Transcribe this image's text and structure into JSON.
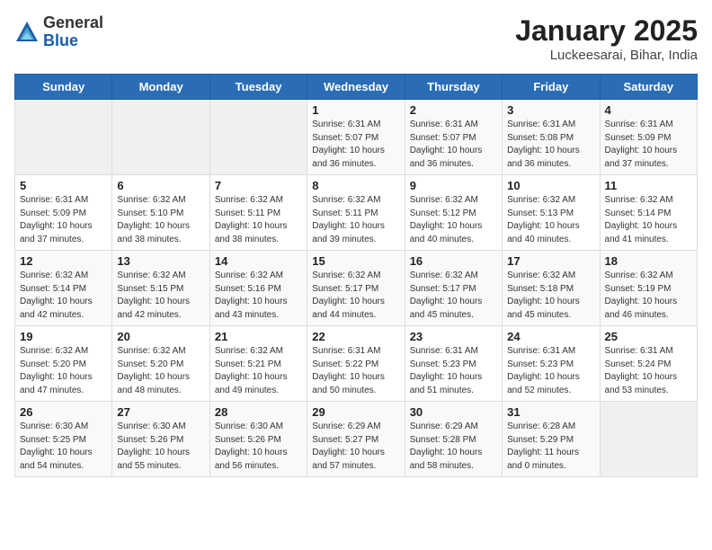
{
  "logo": {
    "general": "General",
    "blue": "Blue"
  },
  "header": {
    "title": "January 2025",
    "subtitle": "Luckeesarai, Bihar, India"
  },
  "weekdays": [
    "Sunday",
    "Monday",
    "Tuesday",
    "Wednesday",
    "Thursday",
    "Friday",
    "Saturday"
  ],
  "weeks": [
    [
      {
        "day": "",
        "info": ""
      },
      {
        "day": "",
        "info": ""
      },
      {
        "day": "",
        "info": ""
      },
      {
        "day": "1",
        "info": "Sunrise: 6:31 AM\nSunset: 5:07 PM\nDaylight: 10 hours\nand 36 minutes."
      },
      {
        "day": "2",
        "info": "Sunrise: 6:31 AM\nSunset: 5:07 PM\nDaylight: 10 hours\nand 36 minutes."
      },
      {
        "day": "3",
        "info": "Sunrise: 6:31 AM\nSunset: 5:08 PM\nDaylight: 10 hours\nand 36 minutes."
      },
      {
        "day": "4",
        "info": "Sunrise: 6:31 AM\nSunset: 5:09 PM\nDaylight: 10 hours\nand 37 minutes."
      }
    ],
    [
      {
        "day": "5",
        "info": "Sunrise: 6:31 AM\nSunset: 5:09 PM\nDaylight: 10 hours\nand 37 minutes."
      },
      {
        "day": "6",
        "info": "Sunrise: 6:32 AM\nSunset: 5:10 PM\nDaylight: 10 hours\nand 38 minutes."
      },
      {
        "day": "7",
        "info": "Sunrise: 6:32 AM\nSunset: 5:11 PM\nDaylight: 10 hours\nand 38 minutes."
      },
      {
        "day": "8",
        "info": "Sunrise: 6:32 AM\nSunset: 5:11 PM\nDaylight: 10 hours\nand 39 minutes."
      },
      {
        "day": "9",
        "info": "Sunrise: 6:32 AM\nSunset: 5:12 PM\nDaylight: 10 hours\nand 40 minutes."
      },
      {
        "day": "10",
        "info": "Sunrise: 6:32 AM\nSunset: 5:13 PM\nDaylight: 10 hours\nand 40 minutes."
      },
      {
        "day": "11",
        "info": "Sunrise: 6:32 AM\nSunset: 5:14 PM\nDaylight: 10 hours\nand 41 minutes."
      }
    ],
    [
      {
        "day": "12",
        "info": "Sunrise: 6:32 AM\nSunset: 5:14 PM\nDaylight: 10 hours\nand 42 minutes."
      },
      {
        "day": "13",
        "info": "Sunrise: 6:32 AM\nSunset: 5:15 PM\nDaylight: 10 hours\nand 42 minutes."
      },
      {
        "day": "14",
        "info": "Sunrise: 6:32 AM\nSunset: 5:16 PM\nDaylight: 10 hours\nand 43 minutes."
      },
      {
        "day": "15",
        "info": "Sunrise: 6:32 AM\nSunset: 5:17 PM\nDaylight: 10 hours\nand 44 minutes."
      },
      {
        "day": "16",
        "info": "Sunrise: 6:32 AM\nSunset: 5:17 PM\nDaylight: 10 hours\nand 45 minutes."
      },
      {
        "day": "17",
        "info": "Sunrise: 6:32 AM\nSunset: 5:18 PM\nDaylight: 10 hours\nand 45 minutes."
      },
      {
        "day": "18",
        "info": "Sunrise: 6:32 AM\nSunset: 5:19 PM\nDaylight: 10 hours\nand 46 minutes."
      }
    ],
    [
      {
        "day": "19",
        "info": "Sunrise: 6:32 AM\nSunset: 5:20 PM\nDaylight: 10 hours\nand 47 minutes."
      },
      {
        "day": "20",
        "info": "Sunrise: 6:32 AM\nSunset: 5:20 PM\nDaylight: 10 hours\nand 48 minutes."
      },
      {
        "day": "21",
        "info": "Sunrise: 6:32 AM\nSunset: 5:21 PM\nDaylight: 10 hours\nand 49 minutes."
      },
      {
        "day": "22",
        "info": "Sunrise: 6:31 AM\nSunset: 5:22 PM\nDaylight: 10 hours\nand 50 minutes."
      },
      {
        "day": "23",
        "info": "Sunrise: 6:31 AM\nSunset: 5:23 PM\nDaylight: 10 hours\nand 51 minutes."
      },
      {
        "day": "24",
        "info": "Sunrise: 6:31 AM\nSunset: 5:23 PM\nDaylight: 10 hours\nand 52 minutes."
      },
      {
        "day": "25",
        "info": "Sunrise: 6:31 AM\nSunset: 5:24 PM\nDaylight: 10 hours\nand 53 minutes."
      }
    ],
    [
      {
        "day": "26",
        "info": "Sunrise: 6:30 AM\nSunset: 5:25 PM\nDaylight: 10 hours\nand 54 minutes."
      },
      {
        "day": "27",
        "info": "Sunrise: 6:30 AM\nSunset: 5:26 PM\nDaylight: 10 hours\nand 55 minutes."
      },
      {
        "day": "28",
        "info": "Sunrise: 6:30 AM\nSunset: 5:26 PM\nDaylight: 10 hours\nand 56 minutes."
      },
      {
        "day": "29",
        "info": "Sunrise: 6:29 AM\nSunset: 5:27 PM\nDaylight: 10 hours\nand 57 minutes."
      },
      {
        "day": "30",
        "info": "Sunrise: 6:29 AM\nSunset: 5:28 PM\nDaylight: 10 hours\nand 58 minutes."
      },
      {
        "day": "31",
        "info": "Sunrise: 6:28 AM\nSunset: 5:29 PM\nDaylight: 11 hours\nand 0 minutes."
      },
      {
        "day": "",
        "info": ""
      }
    ]
  ]
}
